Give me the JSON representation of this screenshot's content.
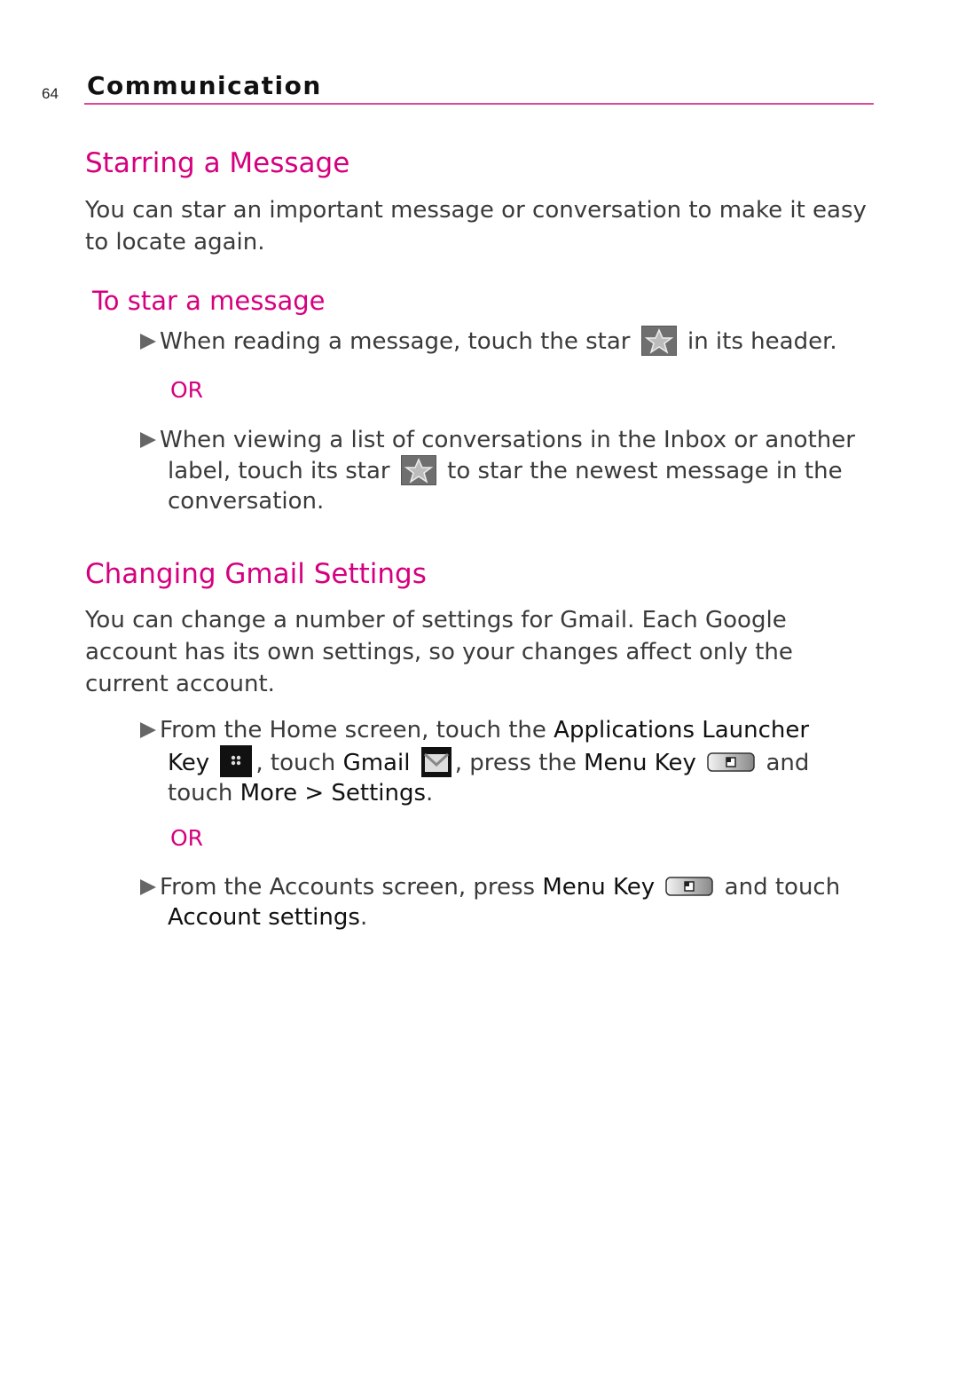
{
  "header": {
    "page_number": "64",
    "section_title": "Communication",
    "accent_color": "#d6007f"
  },
  "starring": {
    "heading": "Starring a Message",
    "intro_line1": "You can star an important message or conversation to make it easy",
    "intro_line2": "to locate again.",
    "subheading": "To star a message",
    "step1": {
      "before": "When reading a message, touch the star",
      "icon": "star-icon",
      "after": "in its header."
    },
    "or1": "OR",
    "step2": {
      "line1": "When viewing a list of conversations in the Inbox or another",
      "before": "label, touch its star",
      "icon": "star-icon",
      "after": "to star the newest message in the",
      "line3": "conversation."
    }
  },
  "gmail_settings": {
    "heading": "Changing Gmail Settings",
    "intro_line1": "You can change a number of settings for Gmail. Each Google",
    "intro_line2": "account has its own settings, so your changes affect only the",
    "intro_line3": "current account.",
    "step1": {
      "t1": "From the Home screen, touch the ",
      "e1": "Applications Launcher",
      "e1b": "Key",
      "icon1": "applications-launcher-icon",
      "t2": ", touch ",
      "e2": "Gmail",
      "icon2": "gmail-icon",
      "t3": ", press the ",
      "e3": "Menu Key",
      "icon3": "menu-key-icon",
      "t4": " and",
      "t5": "touch ",
      "e4": "More > Settings",
      "t6": "."
    },
    "or2": "OR",
    "step2": {
      "t1": "From the Accounts screen, press ",
      "e1": "Menu Key",
      "icon": "menu-key-icon",
      "t2": " and touch",
      "e2": "Account settings",
      "t3": "."
    }
  }
}
